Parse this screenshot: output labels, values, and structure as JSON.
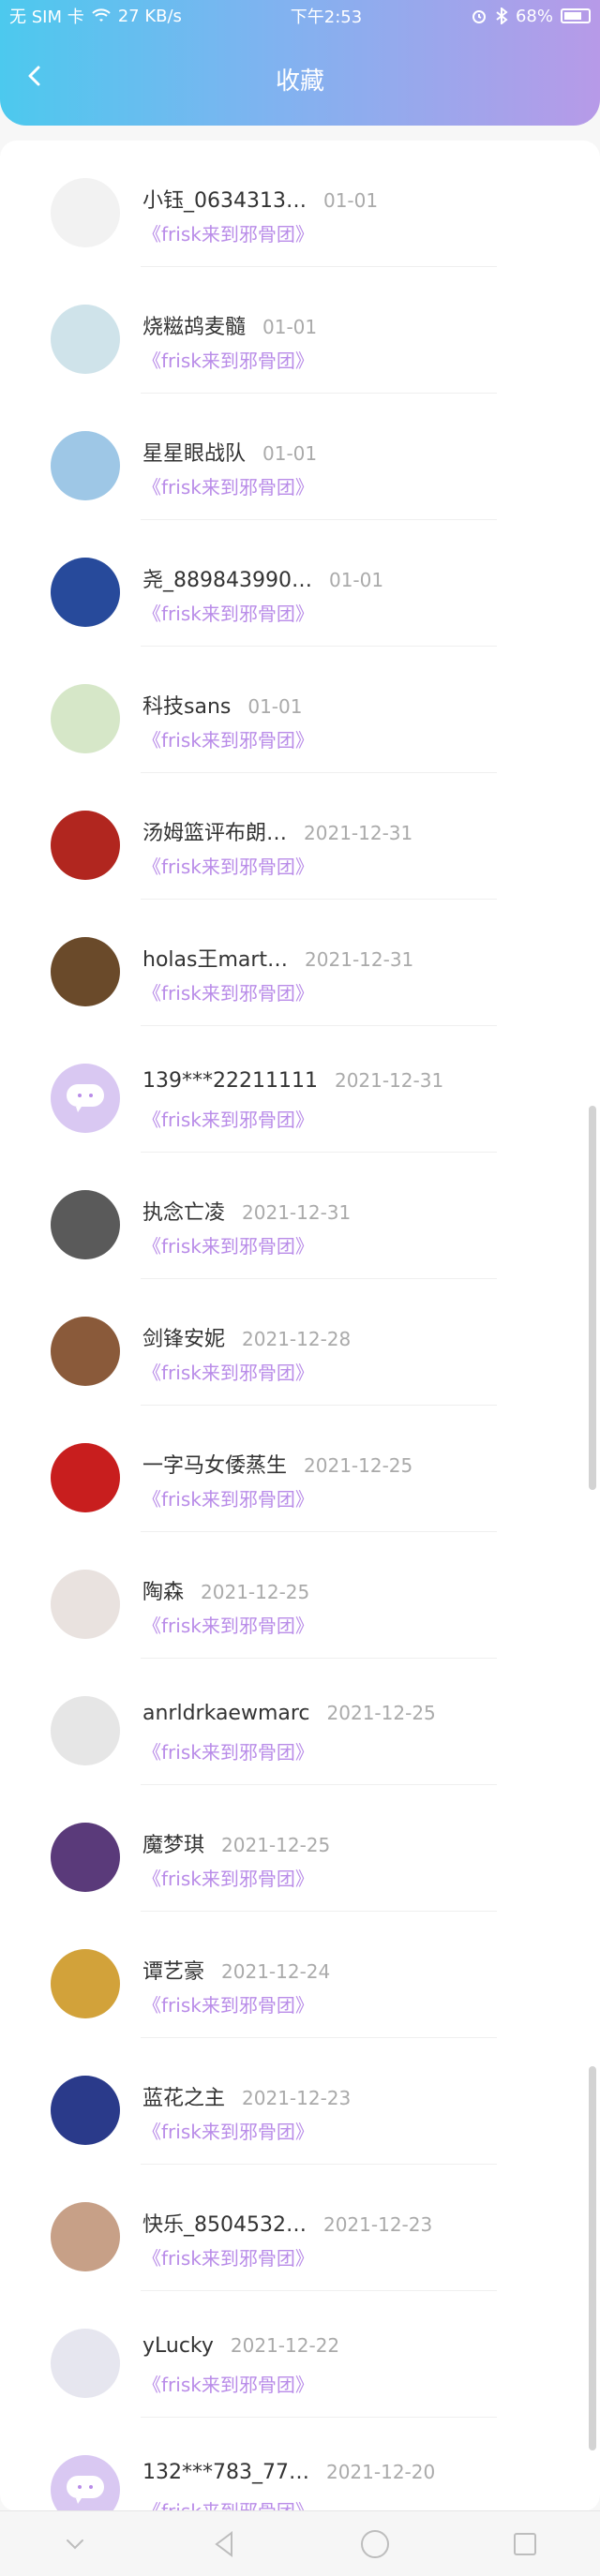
{
  "status": {
    "carrier": "无 SIM 卡",
    "speed": "27 KB/s",
    "time": "下午2:53",
    "battery": "68%"
  },
  "header": {
    "title": "收藏"
  },
  "items": [
    {
      "name": "小钰_0634313…",
      "time": "01-01",
      "subtitle": "《frisk来到邪骨团》",
      "avatar_color": "#f2f2f2"
    },
    {
      "name": "烧糍鸪麦髓",
      "time": "01-01",
      "subtitle": "《frisk来到邪骨团》",
      "avatar_color": "#cfe3ea"
    },
    {
      "name": "星星眼战队",
      "time": "01-01",
      "subtitle": "《frisk来到邪骨团》",
      "avatar_color": "#9ec7e6"
    },
    {
      "name": "尧_889843990…",
      "time": "01-01",
      "subtitle": "《frisk来到邪骨团》",
      "avatar_color": "#274a9b"
    },
    {
      "name": "科技sans",
      "time": "01-01",
      "subtitle": "《frisk来到邪骨团》",
      "avatar_color": "#d6e7c8"
    },
    {
      "name": "汤姆篮评布朗…",
      "time": "2021-12-31",
      "subtitle": "《frisk来到邪骨团》",
      "avatar_color": "#b1261f"
    },
    {
      "name": "holas王mart…",
      "time": "2021-12-31",
      "subtitle": "《frisk来到邪骨团》",
      "avatar_color": "#6a4a2a"
    },
    {
      "name": "139***22211111",
      "time": "2021-12-31",
      "subtitle": "《frisk来到邪骨团》",
      "avatar_color": "#d9c8f2"
    },
    {
      "name": "执念亡凌",
      "time": "2021-12-31",
      "subtitle": "《frisk来到邪骨团》",
      "avatar_color": "#5a5a5a"
    },
    {
      "name": "剑锋安妮",
      "time": "2021-12-28",
      "subtitle": "《frisk来到邪骨团》",
      "avatar_color": "#8a5a3a"
    },
    {
      "name": "一字马女倭蒸生",
      "time": "2021-12-25",
      "subtitle": "《frisk来到邪骨团》",
      "avatar_color": "#c81e1e"
    },
    {
      "name": "陶森",
      "time": "2021-12-25",
      "subtitle": "《frisk来到邪骨团》",
      "avatar_color": "#e9e2df"
    },
    {
      "name": "anrldrkaewmarc",
      "time": "2021-12-25",
      "subtitle": "《frisk来到邪骨团》",
      "avatar_color": "#e6e6e6"
    },
    {
      "name": "魔梦琪",
      "time": "2021-12-25",
      "subtitle": "《frisk来到邪骨团》",
      "avatar_color": "#5a3a7a"
    },
    {
      "name": "谭艺豪",
      "time": "2021-12-24",
      "subtitle": "《frisk来到邪骨团》",
      "avatar_color": "#d2a23a"
    },
    {
      "name": "蓝花之主",
      "time": "2021-12-23",
      "subtitle": "《frisk来到邪骨团》",
      "avatar_color": "#2a3a8a"
    },
    {
      "name": "快乐_8504532…",
      "time": "2021-12-23",
      "subtitle": "《frisk来到邪骨团》",
      "avatar_color": "#c7a087"
    },
    {
      "name": "yLucky",
      "time": "2021-12-22",
      "subtitle": "《frisk来到邪骨团》",
      "avatar_color": "#e6e6ef"
    },
    {
      "name": "132***783_77…",
      "time": "2021-12-20",
      "subtitle": "《frisk来到邪骨团》",
      "avatar_color": "#d9c8f2"
    }
  ],
  "colors": {
    "gradient_start": "#4cc9ee",
    "gradient_end": "#b79ae8",
    "accent_purple": "#b98ce8"
  }
}
